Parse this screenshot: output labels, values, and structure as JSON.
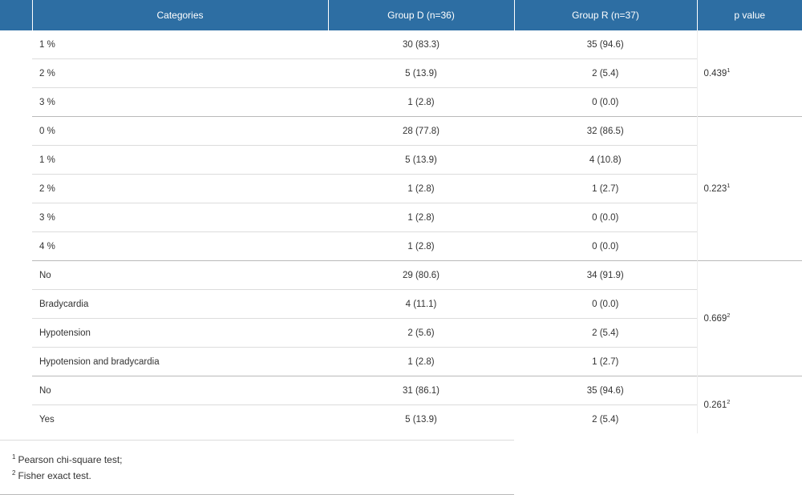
{
  "header": {
    "categories": "Categories",
    "group_d": "Group D (n=36)",
    "group_r": "Group R (n=37)",
    "p_value": "p value"
  },
  "groups": [
    {
      "p_value": "0.439",
      "p_sup": "1",
      "rows": [
        {
          "category": "1 %",
          "group_d": "30 (83.3)",
          "group_r": "35 (94.6)"
        },
        {
          "category": "2 %",
          "group_d": "5 (13.9)",
          "group_r": "2 (5.4)"
        },
        {
          "category": "3 %",
          "group_d": "1 (2.8)",
          "group_r": "0 (0.0)"
        }
      ]
    },
    {
      "p_value": "0.223",
      "p_sup": "1",
      "rows": [
        {
          "category": "0 %",
          "group_d": "28 (77.8)",
          "group_r": "32 (86.5)"
        },
        {
          "category": "1 %",
          "group_d": "5 (13.9)",
          "group_r": "4 (10.8)"
        },
        {
          "category": "2 %",
          "group_d": "1 (2.8)",
          "group_r": "1 (2.7)"
        },
        {
          "category": "3 %",
          "group_d": "1 (2.8)",
          "group_r": "0 (0.0)"
        },
        {
          "category": "4 %",
          "group_d": "1 (2.8)",
          "group_r": "0 (0.0)"
        }
      ]
    },
    {
      "p_value": "0.669",
      "p_sup": "2",
      "rows": [
        {
          "category": "No",
          "group_d": "29 (80.6)",
          "group_r": "34 (91.9)"
        },
        {
          "category": "Bradycardia",
          "group_d": "4 (11.1)",
          "group_r": "0 (0.0)"
        },
        {
          "category": "Hypotension",
          "group_d": "2 (5.6)",
          "group_r": "2 (5.4)"
        },
        {
          "category": "Hypotension and bradycardia",
          "group_d": "1 (2.8)",
          "group_r": "1 (2.7)"
        }
      ]
    },
    {
      "p_value": "0.261",
      "p_sup": "2",
      "rows": [
        {
          "category": "No",
          "group_d": "31 (86.1)",
          "group_r": "35 (94.6)"
        },
        {
          "category": "Yes",
          "group_d": "5 (13.9)",
          "group_r": "2 (5.4)"
        }
      ]
    }
  ],
  "footnotes": [
    {
      "mark": "1",
      "text": "Pearson chi-square test;"
    },
    {
      "mark": "2",
      "text": "Fisher exact test."
    }
  ]
}
